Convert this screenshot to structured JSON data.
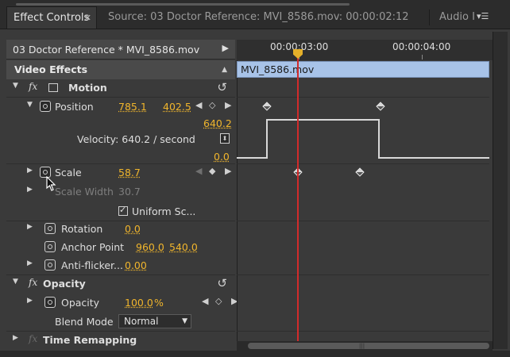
{
  "tabs": {
    "active": "Effect Controls",
    "source": "Source: 03 Doctor Reference: MVI_8586.mov: 00:00:02:12",
    "audio": "Audio I"
  },
  "clip_header": "03 Doctor Reference * MVI_8586.mov",
  "timeline": {
    "timecode_left": "00:00:03:00",
    "timecode_right": "00:00:04:00",
    "clip_name": "MVI_8586.mov"
  },
  "video_effects": {
    "label": "Video Effects",
    "motion": {
      "label": "Motion",
      "position": {
        "label": "Position",
        "x": "785.1",
        "y": "402.5"
      },
      "velocity_max": "640.2",
      "velocity_text": "Velocity: 640.2 / second",
      "velocity_min": "0.0",
      "scale": {
        "label": "Scale",
        "value": "58.7"
      },
      "scale_width": {
        "label": "Scale Width",
        "value": "30.7"
      },
      "uniform_scale": "Uniform Sc...",
      "rotation": {
        "label": "Rotation",
        "value": "0.0"
      },
      "anchor_point": {
        "label": "Anchor Point",
        "x": "960.0",
        "y": "540.0"
      },
      "anti_flicker": {
        "label": "Anti-flicker...",
        "value": "0.00"
      }
    },
    "opacity": {
      "label": "Opacity",
      "opacity_prop": {
        "label": "Opacity",
        "value": "100.0",
        "unit": "%"
      },
      "blend_mode": {
        "label": "Blend Mode",
        "value": "Normal"
      }
    },
    "time_remapping": {
      "label": "Time Remapping"
    }
  },
  "colors": {
    "value": "#f0b52c",
    "playhead": "#d12b2b",
    "clip_bar": "#a8c3e8"
  },
  "icons": [
    "close-icon",
    "panel-menu-icon",
    "expand-arrow-icon",
    "stopwatch-icon",
    "reset-icon",
    "keyframe-icon",
    "playhead-icon",
    "mouse-cursor-icon"
  ]
}
